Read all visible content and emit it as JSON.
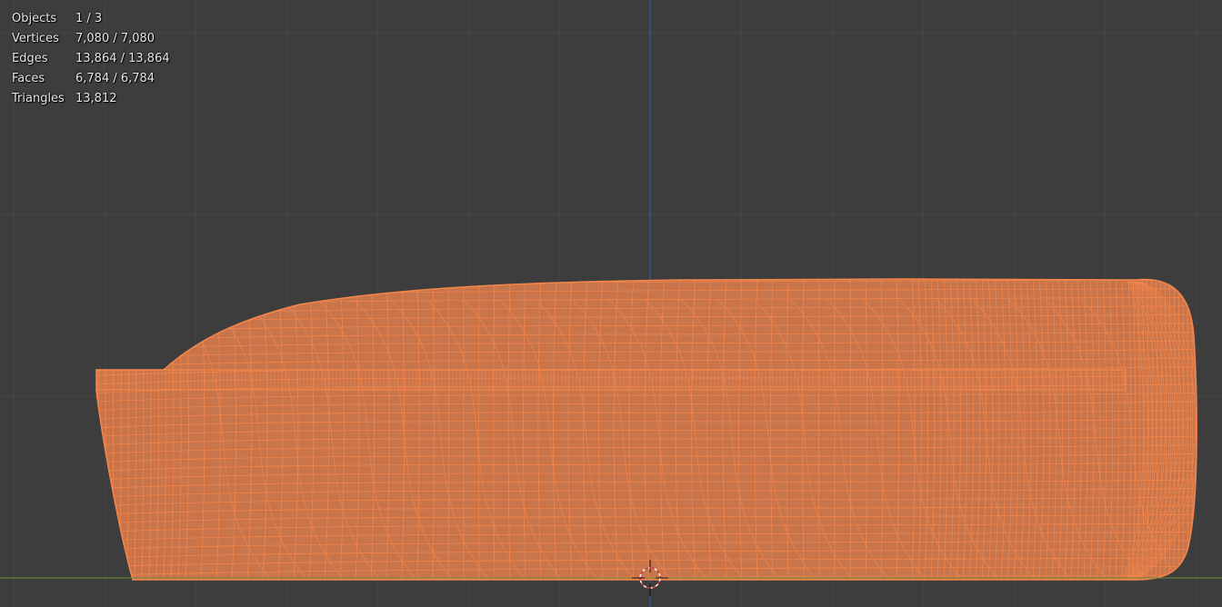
{
  "viewport": {
    "background": "#3d3d3d",
    "grid_color": "#454545",
    "y_axis_color": "#2f5fa8",
    "x_axis_color": "#6a8a3a",
    "wire_color": "#f5864a",
    "fill_color": "#c9754c",
    "cursor_icon": "3d-cursor-icon",
    "mode": "Wireframe with face overlay, selected object"
  },
  "stats": {
    "objects_label": "Objects",
    "objects_value": "1 / 3",
    "vertices_label": "Vertices",
    "vertices_value": "7,080 / 7,080",
    "edges_label": "Edges",
    "edges_value": "13,864 / 13,864",
    "faces_label": "Faces",
    "faces_value": "6,784 / 6,784",
    "triangles_label": "Triangles",
    "triangles_value": "13,812"
  }
}
